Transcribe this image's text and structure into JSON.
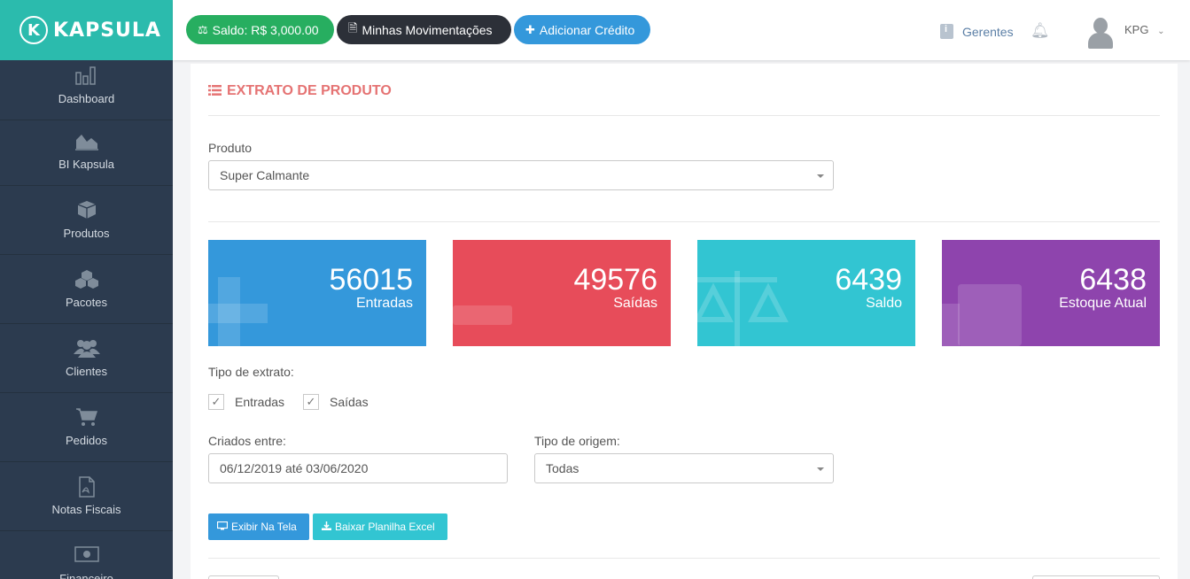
{
  "brand": {
    "name": "KAPSULA",
    "mark": "K"
  },
  "header": {
    "saldo_label": "Saldo: R$ 3,000.00",
    "movimentacoes_label": "Minhas Movimentações",
    "adicionar_label": "Adicionar Crédito",
    "gerentes_label": "Gerentes",
    "user_name": "KPG"
  },
  "sidebar": {
    "items": [
      {
        "label": "Dashboard",
        "icon": "bar-chart-icon"
      },
      {
        "label": "BI Kapsula",
        "icon": "area-chart-icon"
      },
      {
        "label": "Produtos",
        "icon": "cube-icon"
      },
      {
        "label": "Pacotes",
        "icon": "cubes-icon"
      },
      {
        "label": "Clientes",
        "icon": "users-icon"
      },
      {
        "label": "Pedidos",
        "icon": "cart-icon"
      },
      {
        "label": "Notas Fiscais",
        "icon": "file-pdf-icon"
      },
      {
        "label": "Financeiro",
        "icon": "money-icon"
      }
    ]
  },
  "page": {
    "title": "EXTRATO DE PRODUTO",
    "produto_label": "Produto",
    "produto_value": "Super Calmante",
    "cards": [
      {
        "value": "56015",
        "label": "Entradas",
        "color": "#3498db"
      },
      {
        "value": "49576",
        "label": "Saídas",
        "color": "#e74c5a"
      },
      {
        "value": "6439",
        "label": "Saldo",
        "color": "#32c5d2"
      },
      {
        "value": "6438",
        "label": "Estoque Atual",
        "color": "#8e44ad"
      }
    ],
    "tipo_extrato_label": "Tipo de extrato:",
    "check_entradas": "Entradas",
    "check_saidas": "Saídas",
    "criados_label": "Criados entre:",
    "criados_value": "06/12/2019 até 03/06/2020",
    "origem_label": "Tipo de origem:",
    "origem_value": "Todas",
    "btn_exibir": "Exibir Na Tela",
    "btn_baixar": "Baixar Planilha Excel"
  }
}
